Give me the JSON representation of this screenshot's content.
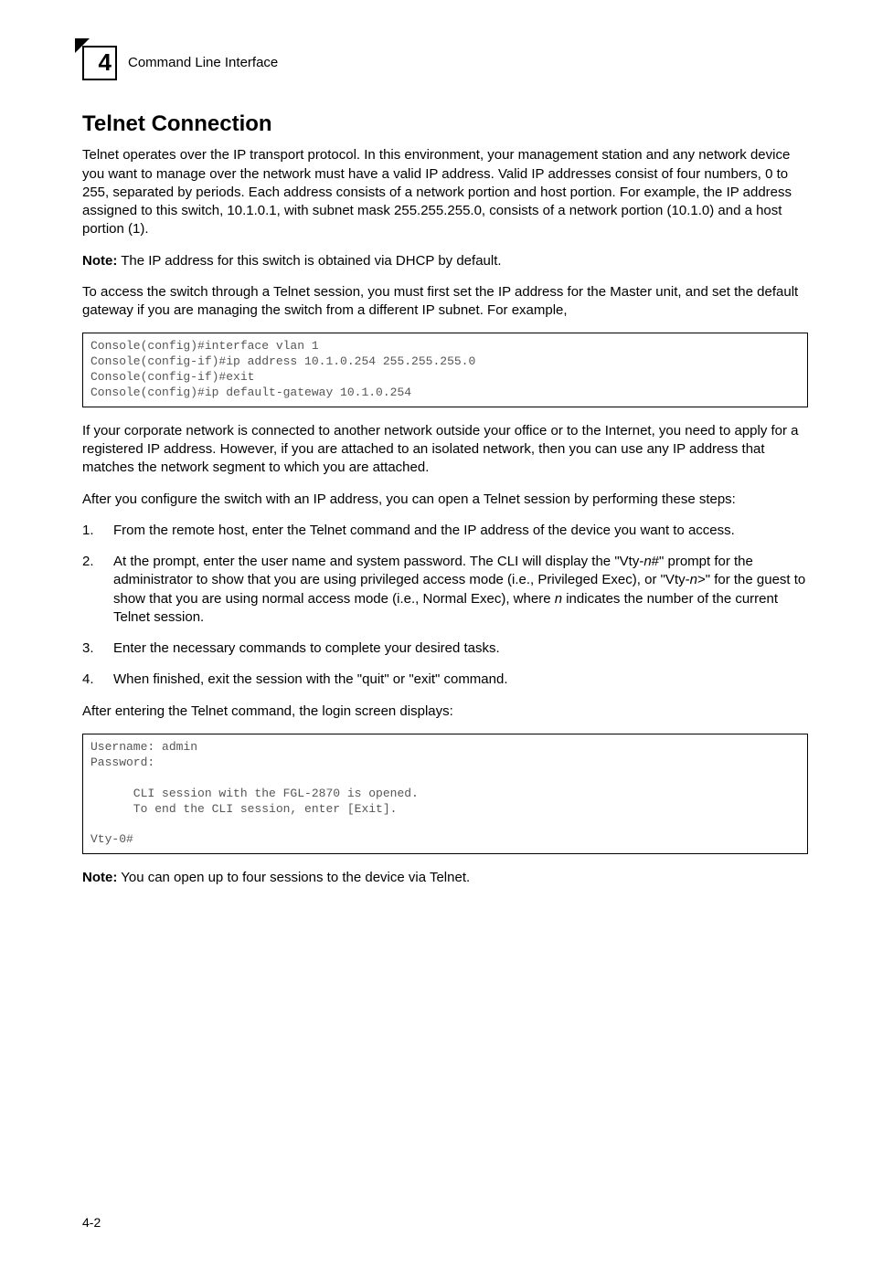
{
  "header": {
    "chapter_number": "4",
    "chapter_title": "Command Line Interface"
  },
  "section": {
    "title": "Telnet Connection",
    "intro": "Telnet operates over the IP transport protocol. In this environment, your management station and any network device you want to manage over the network must have a valid IP address. Valid IP addresses consist of four numbers, 0 to 255, separated by periods. Each address consists of a network portion and host portion. For example, the IP address assigned to this switch, 10.1.0.1, with subnet mask 255.255.255.0, consists of a network portion (10.1.0) and a host portion (1).",
    "note1_label": "Note:",
    "note1_text": " The IP address for this switch is obtained via DHCP by default.",
    "para2": "To access the switch through a Telnet session, you must first set the IP address for the Master unit, and set the default gateway if you are managing the switch from a different IP subnet. For example,",
    "code1": "Console(config)#interface vlan 1\nConsole(config-if)#ip address 10.1.0.254 255.255.255.0\nConsole(config-if)#exit\nConsole(config)#ip default-gateway 10.1.0.254",
    "para3": "If your corporate network is connected to another network outside your office or to the Internet, you need to apply for a registered IP address. However, if you are attached to an isolated network, then you can use any IP address that matches the network segment to which you are attached.",
    "para4": "After you configure the switch with an IP address, you can open a Telnet session by performing these steps:",
    "steps": [
      {
        "num": "1.",
        "text_parts": [
          "From the remote host, enter the Telnet command and the IP address of the device you want to access."
        ]
      },
      {
        "num": "2.",
        "text_parts": [
          "At the prompt, enter the user name and system password. The CLI will display the \"Vty-",
          "n",
          "#\" prompt for the administrator to show that you are using privileged access mode (i.e., Privileged Exec), or \"Vty-",
          "n",
          ">\" for the guest to show that you are using normal access mode (i.e., Normal Exec), where ",
          "n",
          " indicates the number of the current Telnet session."
        ]
      },
      {
        "num": "3.",
        "text_parts": [
          "Enter the necessary commands to complete your desired tasks."
        ]
      },
      {
        "num": "4.",
        "text_parts": [
          "When finished, exit the session with the \"quit\" or \"exit\" command."
        ]
      }
    ],
    "para5": "After entering the Telnet command, the login screen displays:",
    "code2": "Username: admin\nPassword:\n\n      CLI session with the FGL-2870 is opened.\n      To end the CLI session, enter [Exit].\n\nVty-0#",
    "note2_label": "Note:",
    "note2_text": " You can open up to four sessions to the device via Telnet."
  },
  "footer": {
    "page": "4-2"
  }
}
